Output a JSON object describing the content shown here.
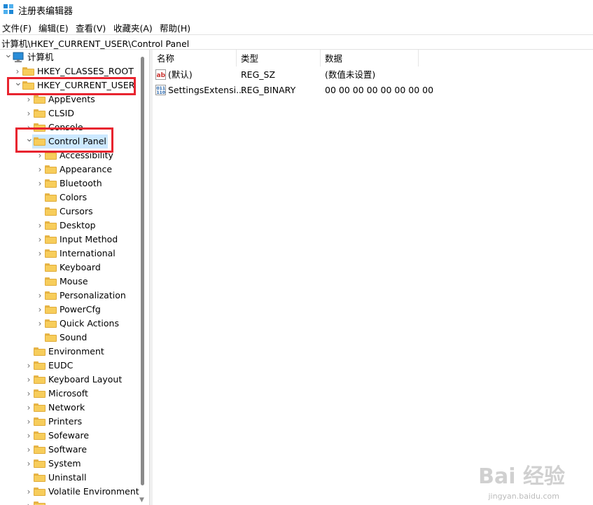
{
  "window": {
    "title": "注册表编辑器"
  },
  "menu": [
    "文件(F)",
    "编辑(E)",
    "查看(V)",
    "收藏夹(A)",
    "帮助(H)"
  ],
  "address": "计算机\\HKEY_CURRENT_USER\\Control Panel",
  "tree": [
    {
      "label": "计算机",
      "level": 0,
      "expander": "expanded",
      "icon": "computer-icon"
    },
    {
      "label": "HKEY_CLASSES_ROOT",
      "level": 1,
      "expander": "collapsed"
    },
    {
      "label": "HKEY_CURRENT_USER",
      "level": 1,
      "expander": "expanded"
    },
    {
      "label": "AppEvents",
      "level": 2,
      "expander": "collapsed"
    },
    {
      "label": "CLSID",
      "level": 2,
      "expander": "collapsed"
    },
    {
      "label": "Console",
      "level": 2,
      "expander": "collapsed"
    },
    {
      "label": "Control Panel",
      "level": 2,
      "expander": "expanded",
      "selected": true
    },
    {
      "label": "Accessibility",
      "level": 3,
      "expander": "collapsed"
    },
    {
      "label": "Appearance",
      "level": 3,
      "expander": "collapsed"
    },
    {
      "label": "Bluetooth",
      "level": 3,
      "expander": "collapsed"
    },
    {
      "label": "Colors",
      "level": 3,
      "expander": "none"
    },
    {
      "label": "Cursors",
      "level": 3,
      "expander": "none"
    },
    {
      "label": "Desktop",
      "level": 3,
      "expander": "collapsed"
    },
    {
      "label": "Input Method",
      "level": 3,
      "expander": "collapsed"
    },
    {
      "label": "International",
      "level": 3,
      "expander": "collapsed"
    },
    {
      "label": "Keyboard",
      "level": 3,
      "expander": "none"
    },
    {
      "label": "Mouse",
      "level": 3,
      "expander": "none"
    },
    {
      "label": "Personalization",
      "level": 3,
      "expander": "collapsed"
    },
    {
      "label": "PowerCfg",
      "level": 3,
      "expander": "collapsed"
    },
    {
      "label": "Quick Actions",
      "level": 3,
      "expander": "collapsed"
    },
    {
      "label": "Sound",
      "level": 3,
      "expander": "none"
    },
    {
      "label": "Environment",
      "level": 2,
      "expander": "none"
    },
    {
      "label": "EUDC",
      "level": 2,
      "expander": "collapsed"
    },
    {
      "label": "Keyboard Layout",
      "level": 2,
      "expander": "collapsed"
    },
    {
      "label": "Microsoft",
      "level": 2,
      "expander": "collapsed"
    },
    {
      "label": "Network",
      "level": 2,
      "expander": "collapsed"
    },
    {
      "label": "Printers",
      "level": 2,
      "expander": "collapsed"
    },
    {
      "label": "Sofeware",
      "level": 2,
      "expander": "collapsed"
    },
    {
      "label": "Software",
      "level": 2,
      "expander": "collapsed"
    },
    {
      "label": "System",
      "level": 2,
      "expander": "collapsed"
    },
    {
      "label": "Uninstall",
      "level": 2,
      "expander": "none"
    },
    {
      "label": "Volatile Environment",
      "level": 2,
      "expander": "collapsed"
    },
    {
      "label": "",
      "level": 2,
      "expander": "collapsed"
    }
  ],
  "list": {
    "columns": [
      "名称",
      "类型",
      "数据"
    ],
    "rows": [
      {
        "name": "(默认)",
        "type": "REG_SZ",
        "data": "(数值未设置)",
        "icon": "string-value-icon"
      },
      {
        "name": "SettingsExtensi...",
        "type": "REG_BINARY",
        "data": "00 00 00 00 00 00 00 00",
        "icon": "binary-value-icon"
      }
    ]
  },
  "watermark": {
    "main": "Bai 经验",
    "sub": "jingyan.baidu.com"
  },
  "colors": {
    "highlight": "#e8242f",
    "selection": "#cce8ff",
    "folder": "#f7cd5b"
  }
}
